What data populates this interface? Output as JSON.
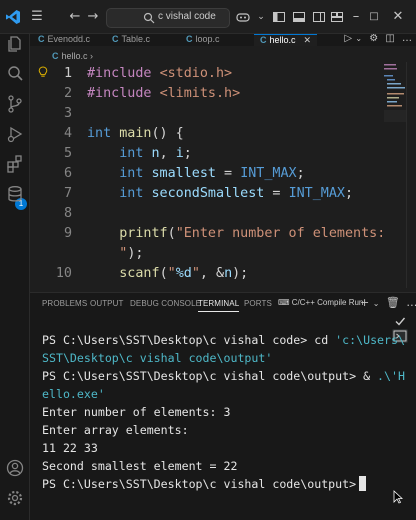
{
  "titlebar": {
    "search_text": "c vishal code"
  },
  "activity_bar": {
    "extensions_badge": "1"
  },
  "tabs": [
    {
      "label": "Evenodd.c",
      "icon": "C"
    },
    {
      "label": "Table.c",
      "icon": "C"
    },
    {
      "label": "loop.c",
      "icon": "C"
    },
    {
      "label": "hello.c",
      "icon": "C",
      "active": true
    }
  ],
  "breadcrumb": {
    "file": "hello.c",
    "icon": "C"
  },
  "editor": {
    "lines": [
      {
        "n": "1",
        "tokens": [
          [
            "pp",
            "#include "
          ],
          [
            "inc",
            "<stdio.h>"
          ]
        ]
      },
      {
        "n": "2",
        "tokens": [
          [
            "pp",
            "#include "
          ],
          [
            "inc",
            "<limits.h>"
          ]
        ]
      },
      {
        "n": "3",
        "tokens": []
      },
      {
        "n": "4",
        "tokens": [
          [
            "kw",
            "int "
          ],
          [
            "fn",
            "main"
          ],
          [
            "pl",
            "() {"
          ]
        ]
      },
      {
        "n": "5",
        "tokens": [
          [
            "pl",
            "    "
          ],
          [
            "kw",
            "int "
          ],
          [
            "var",
            "n"
          ],
          [
            "pl",
            ", "
          ],
          [
            "var",
            "i"
          ],
          [
            "pl",
            ";"
          ]
        ]
      },
      {
        "n": "6",
        "tokens": [
          [
            "pl",
            "    "
          ],
          [
            "kw",
            "int "
          ],
          [
            "var",
            "smallest"
          ],
          [
            "pl",
            " = "
          ],
          [
            "mac",
            "INT_MAX"
          ],
          [
            "pl",
            ";"
          ]
        ]
      },
      {
        "n": "7",
        "tokens": [
          [
            "pl",
            "    "
          ],
          [
            "kw",
            "int "
          ],
          [
            "var",
            "secondSmallest"
          ],
          [
            "pl",
            " = "
          ],
          [
            "mac",
            "INT_MAX"
          ],
          [
            "pl",
            ";"
          ]
        ]
      },
      {
        "n": "8",
        "tokens": []
      },
      {
        "n": "9",
        "tokens": [
          [
            "pl",
            "    "
          ],
          [
            "fn",
            "printf"
          ],
          [
            "pl",
            "("
          ],
          [
            "str",
            "\"Enter number of elements: "
          ]
        ]
      },
      {
        "n": "",
        "tokens": [
          [
            "str",
            "    \""
          ],
          [
            "pl",
            ");"
          ]
        ]
      },
      {
        "n": "10",
        "tokens": [
          [
            "pl",
            "    "
          ],
          [
            "fn",
            "scanf"
          ],
          [
            "pl",
            "("
          ],
          [
            "str",
            "\""
          ],
          [
            "fmt",
            "%d"
          ],
          [
            "str",
            "\""
          ],
          [
            "pl",
            ", &"
          ],
          [
            "var",
            "n"
          ],
          [
            "pl",
            ");"
          ]
        ]
      }
    ]
  },
  "panel": {
    "tabs": [
      "PROBLEMS",
      "OUTPUT",
      "DEBUG CONSOLE",
      "TERMINAL",
      "PORTS"
    ],
    "active_tab": "TERMINAL",
    "terminal_name": "C/C++ Compile Run",
    "terminal_lines": [
      {
        "parts": [
          [
            "cmd",
            "PS C:\\Users\\SST\\Desktop\\c vishal code> cd "
          ],
          [
            "qs",
            "'c:\\Users\\"
          ]
        ]
      },
      {
        "parts": [
          [
            "qs",
            "SST\\Desktop\\c vishal code\\output'"
          ]
        ]
      },
      {
        "parts": [
          [
            "cmd",
            "PS C:\\Users\\SST\\Desktop\\c vishal code\\output> & "
          ],
          [
            "qs",
            ".\\'H"
          ]
        ]
      },
      {
        "parts": [
          [
            "qs",
            "ello.exe'"
          ]
        ]
      },
      {
        "parts": [
          [
            "cmd",
            "Enter number of elements: 3"
          ]
        ]
      },
      {
        "parts": [
          [
            "cmd",
            "Enter array elements:"
          ]
        ]
      },
      {
        "parts": [
          [
            "cmd",
            "11 22 33"
          ]
        ]
      },
      {
        "parts": [
          [
            "cmd",
            "Second smallest element = 22"
          ]
        ]
      },
      {
        "parts": [
          [
            "cmd",
            "PS C:\\Users\\SST\\Desktop\\c vishal code\\output>"
          ]
        ],
        "cursor": true
      }
    ]
  },
  "colors": {
    "accent": "#0078d4",
    "keyword": "#569cd6",
    "string": "#ce9178",
    "function": "#dcdcaa"
  }
}
